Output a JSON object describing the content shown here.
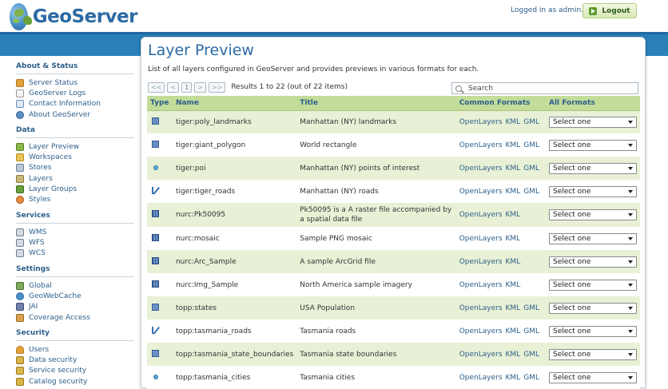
{
  "header": {
    "app_name": "GeoServer",
    "logged_in_text": "Logged in as admin.",
    "logout_label": "Logout"
  },
  "sidebar": {
    "sections": [
      {
        "title": "About & Status",
        "items": [
          {
            "label": "Server Status",
            "icon": "server-status-icon"
          },
          {
            "label": "GeoServer Logs",
            "icon": "logs-icon"
          },
          {
            "label": "Contact Information",
            "icon": "contact-icon"
          },
          {
            "label": "About GeoServer",
            "icon": "about-icon"
          }
        ]
      },
      {
        "title": "Data",
        "items": [
          {
            "label": "Layer Preview",
            "icon": "layer-preview-icon"
          },
          {
            "label": "Workspaces",
            "icon": "workspaces-icon"
          },
          {
            "label": "Stores",
            "icon": "stores-icon"
          },
          {
            "label": "Layers",
            "icon": "layers-icon"
          },
          {
            "label": "Layer Groups",
            "icon": "layer-groups-icon"
          },
          {
            "label": "Styles",
            "icon": "styles-icon"
          }
        ]
      },
      {
        "title": "Services",
        "items": [
          {
            "label": "WMS",
            "icon": "wms-icon"
          },
          {
            "label": "WFS",
            "icon": "wfs-icon"
          },
          {
            "label": "WCS",
            "icon": "wcs-icon"
          }
        ]
      },
      {
        "title": "Settings",
        "items": [
          {
            "label": "Global",
            "icon": "global-icon"
          },
          {
            "label": "GeoWebCache",
            "icon": "geowebcache-icon"
          },
          {
            "label": "JAI",
            "icon": "jai-icon"
          },
          {
            "label": "Coverage Access",
            "icon": "coverage-access-icon"
          }
        ]
      },
      {
        "title": "Security",
        "items": [
          {
            "label": "Users",
            "icon": "users-icon"
          },
          {
            "label": "Data security",
            "icon": "data-security-icon"
          },
          {
            "label": "Service security",
            "icon": "service-security-icon"
          },
          {
            "label": "Catalog security",
            "icon": "catalog-security-icon"
          }
        ]
      }
    ]
  },
  "main": {
    "title": "Layer Preview",
    "description": "List of all layers configured in GeoServer and provides previews in various formats for each.",
    "pager": {
      "first": "<<",
      "prev": "<",
      "current": "1",
      "next": ">",
      "last": ">>",
      "results_text": "Results 1 to 22 (out of 22 items)"
    },
    "search_placeholder": "Search",
    "columns": {
      "type": "Type",
      "name": "Name",
      "title": "Title",
      "common_formats": "Common Formats",
      "all_formats": "All Formats"
    },
    "select_label": "Select one",
    "rows": [
      {
        "type": "polygon",
        "name": "tiger:poly_landmarks",
        "title": "Manhattan (NY) landmarks",
        "formats": [
          "OpenLayers",
          "KML",
          "GML"
        ]
      },
      {
        "type": "polygon",
        "name": "tiger:giant_polygon",
        "title": "World rectangle",
        "formats": [
          "OpenLayers",
          "KML",
          "GML"
        ]
      },
      {
        "type": "point",
        "name": "tiger:poi",
        "title": "Manhattan (NY) points of interest",
        "formats": [
          "OpenLayers",
          "KML",
          "GML"
        ]
      },
      {
        "type": "line",
        "name": "tiger:tiger_roads",
        "title": "Manhattan (NY) roads",
        "formats": [
          "OpenLayers",
          "KML",
          "GML"
        ]
      },
      {
        "type": "raster",
        "name": "nurc:Pk50095",
        "title": "Pk50095 is a A raster file accompanied by a spatial data file",
        "formats": [
          "OpenLayers",
          "KML"
        ]
      },
      {
        "type": "raster",
        "name": "nurc:mosaic",
        "title": "Sample PNG mosaic",
        "formats": [
          "OpenLayers",
          "KML"
        ]
      },
      {
        "type": "raster",
        "name": "nurc:Arc_Sample",
        "title": "A sample ArcGrid file",
        "formats": [
          "OpenLayers",
          "KML"
        ]
      },
      {
        "type": "raster",
        "name": "nurc:Img_Sample",
        "title": "North America sample imagery",
        "formats": [
          "OpenLayers",
          "KML"
        ]
      },
      {
        "type": "polygon",
        "name": "topp:states",
        "title": "USA Population",
        "formats": [
          "OpenLayers",
          "KML",
          "GML"
        ]
      },
      {
        "type": "line",
        "name": "topp:tasmania_roads",
        "title": "Tasmania roads",
        "formats": [
          "OpenLayers",
          "KML",
          "GML"
        ]
      },
      {
        "type": "polygon",
        "name": "topp:tasmania_state_boundaries",
        "title": "Tasmania state boundaries",
        "formats": [
          "OpenLayers",
          "KML",
          "GML"
        ]
      },
      {
        "type": "point",
        "name": "topp:tasmania_cities",
        "title": "Tasmania cities",
        "formats": [
          "OpenLayers",
          "KML",
          "GML"
        ]
      }
    ]
  }
}
